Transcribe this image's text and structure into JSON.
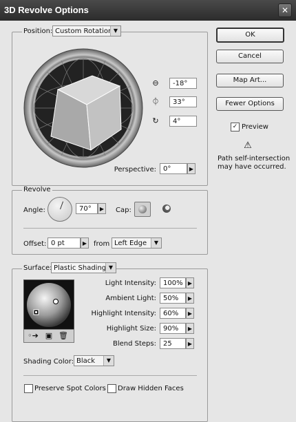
{
  "window": {
    "title": "3D Revolve Options",
    "close_glyph": "✕"
  },
  "buttons": {
    "ok": "OK",
    "cancel": "Cancel",
    "map_art": "Map Art...",
    "fewer_options": "Fewer Options"
  },
  "preview": {
    "label": "Preview",
    "checked": true,
    "check_glyph": "✓"
  },
  "warning": {
    "icon": "warning-icon",
    "glyph": "⚠",
    "line1": "Path self-intersection",
    "line2": "may have occurred."
  },
  "position": {
    "label": "Position:",
    "dropdown": "Custom Rotation",
    "x_rotation": "-18°",
    "y_rotation": "33°",
    "z_rotation": "4°",
    "perspective_label": "Perspective:",
    "perspective_value": "0°"
  },
  "revolve": {
    "group_label": "Revolve",
    "angle_label": "Angle:",
    "angle_value": "70°",
    "cap_label": "Cap:",
    "offset_label": "Offset:",
    "offset_value": "0 pt",
    "from_label": "from",
    "from_value": "Left Edge"
  },
  "surface": {
    "label": "Surface:",
    "dropdown": "Plastic Shading",
    "light_intensity_label": "Light Intensity:",
    "light_intensity_value": "100%",
    "ambient_light_label": "Ambient Light:",
    "ambient_light_value": "50%",
    "highlight_intensity_label": "Highlight Intensity:",
    "highlight_intensity_value": "60%",
    "highlight_size_label": "Highlight Size:",
    "highlight_size_value": "90%",
    "blend_steps_label": "Blend Steps:",
    "blend_steps_value": "25",
    "shading_color_label": "Shading Color:",
    "shading_color_value": "Black"
  },
  "options": {
    "preserve_spot_colors": "Preserve Spot Colors",
    "draw_hidden_faces": "Draw Hidden Faces"
  },
  "glyphs": {
    "dropdown_arrow": "▼",
    "stepper_arrow": "▶"
  },
  "colors": {
    "titlebar": "#2c2c2c",
    "dialog_bg": "#e6e6e6"
  }
}
